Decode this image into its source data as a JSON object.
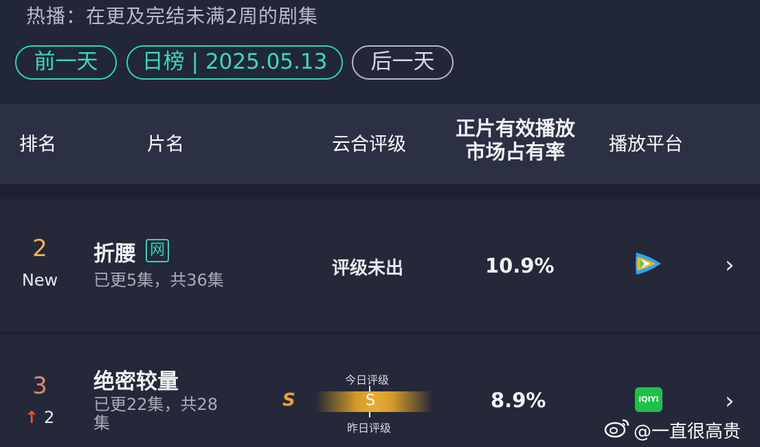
{
  "header": {
    "subtitle": "热播：在更及完结未满2周的剧集",
    "prev_day": "前一天",
    "current": "日榜 | 2025.05.13",
    "next_day": "后一天"
  },
  "table": {
    "columns": {
      "rank": "排名",
      "title": "片名",
      "grade": "云合评级",
      "share_line1": "正片有效播放",
      "share_line2": "市场占有率",
      "platform": "播放平台"
    },
    "rows": [
      {
        "rank": "2",
        "rank_change": "New",
        "title": "折腰",
        "tag": "网",
        "episodes": "已更5集，共36集",
        "grade": "评级未出",
        "share": "10.9%",
        "platform_icon": "tencent-video-icon"
      },
      {
        "rank": "3",
        "rank_change_arrow": "↑",
        "rank_change": "2",
        "title": "绝密较量",
        "episodes_line1": "已更22集，共28",
        "episodes_line2": "集",
        "grade_today_label": "今日评级",
        "grade_yesterday_label": "昨日评级",
        "grade_today": "S",
        "grade_yesterday": "S",
        "share": "8.9%",
        "platform_icon": "iqiyi-icon",
        "platform_text": "iQIYI"
      }
    ]
  },
  "watermark": "@一直很高贵",
  "colors": {
    "accent": "#2dd6b0",
    "rank2": "#f0b44a",
    "rank3": "#d98a6a",
    "up_arrow": "#e2543e",
    "grade_s": "#e7a33a"
  }
}
